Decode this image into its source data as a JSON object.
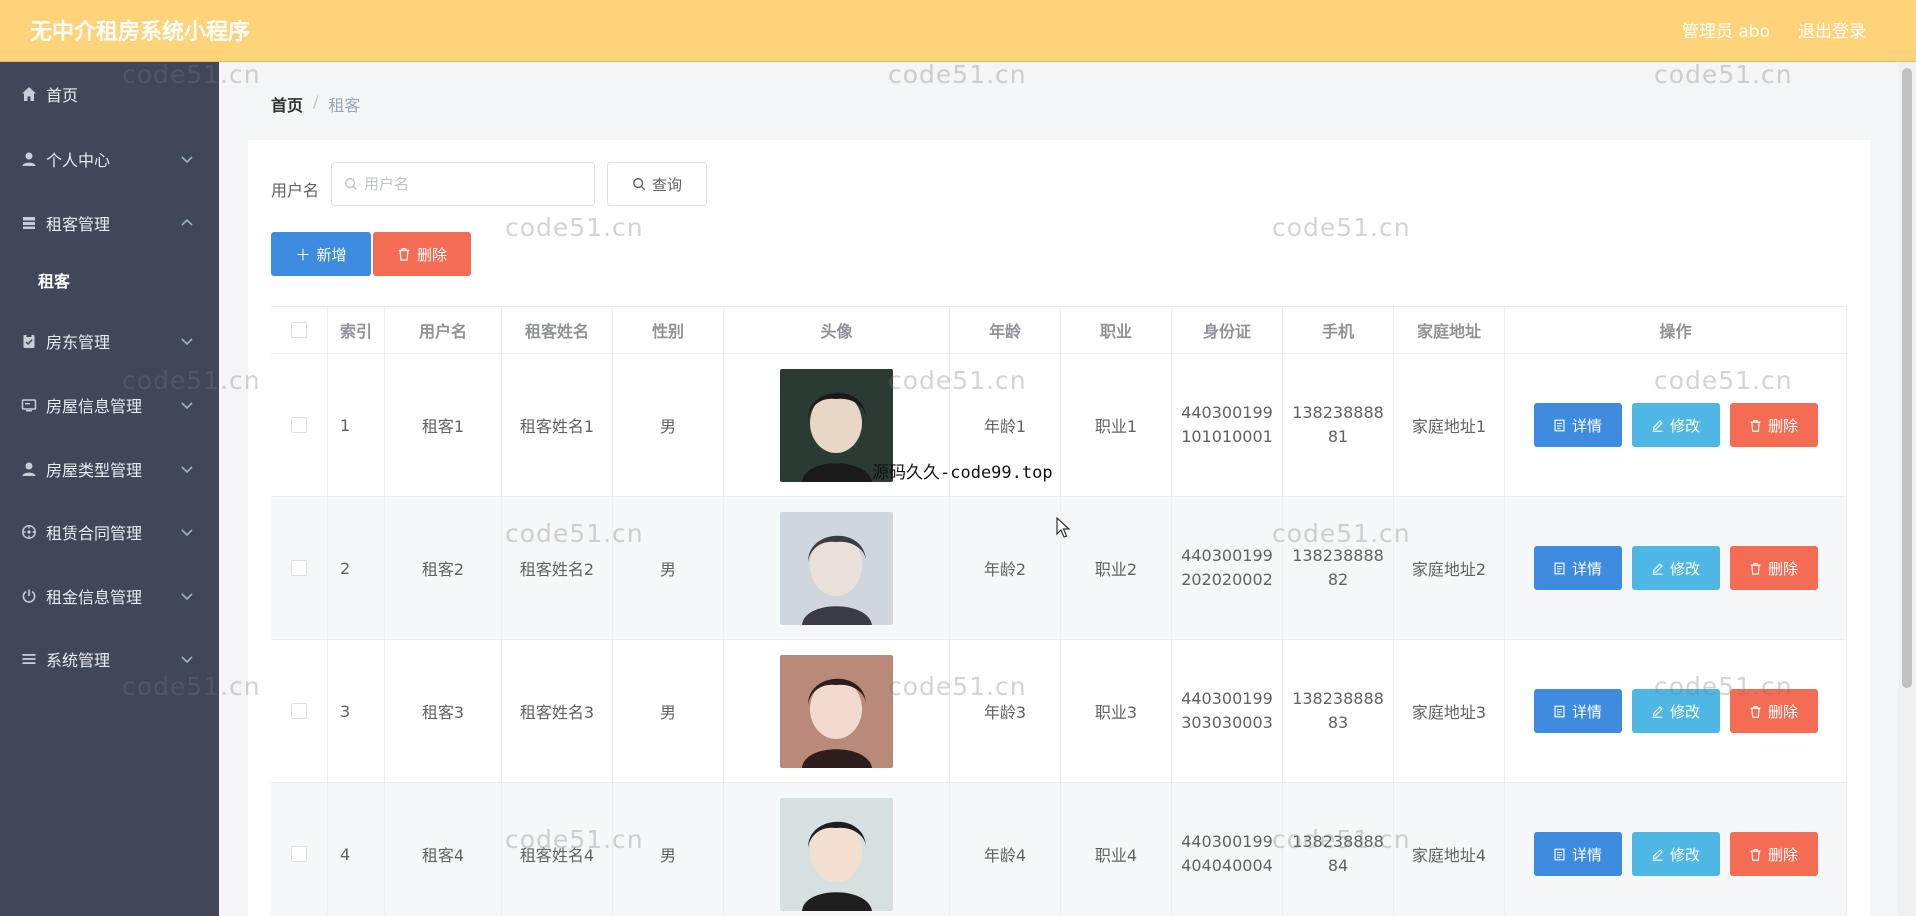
{
  "header": {
    "app_title": "无中介租房系统小程序",
    "admin_label": "管理员 abo",
    "logout_label": "退出登录",
    "bg_color": "#ffd37a"
  },
  "sidebar": {
    "items": [
      {
        "label": "首页",
        "icon": "home-icon"
      },
      {
        "label": "个人中心",
        "icon": "user-icon"
      },
      {
        "label": "租客管理",
        "icon": "list-icon",
        "expanded": true
      },
      {
        "label": "房东管理",
        "icon": "clipboard-icon"
      },
      {
        "label": "房屋信息管理",
        "icon": "monitor-icon"
      },
      {
        "label": "房屋类型管理",
        "icon": "user-icon"
      },
      {
        "label": "租赁合同管理",
        "icon": "compass-icon"
      },
      {
        "label": "租金信息管理",
        "icon": "power-icon"
      },
      {
        "label": "系统管理",
        "icon": "menu-icon"
      }
    ],
    "sub_item": "租客"
  },
  "breadcrumb": {
    "home": "首页",
    "separator": "/",
    "current": "租客"
  },
  "search": {
    "label": "用户名",
    "placeholder": "用户名",
    "query_label": "查询"
  },
  "actions": {
    "add_label": "新增",
    "delete_label": "删除"
  },
  "table": {
    "headers": [
      "索引",
      "用户名",
      "租客姓名",
      "性别",
      "头像",
      "年龄",
      "职业",
      "身份证",
      "手机",
      "家庭地址",
      "操作"
    ],
    "rows": [
      {
        "index": "1",
        "username": "租客1",
        "name": "租客姓名1",
        "gender": "男",
        "age": "年龄1",
        "job": "职业1",
        "id_card": "440300199101010001",
        "phone": "13823888881",
        "address": "家庭地址1"
      },
      {
        "index": "2",
        "username": "租客2",
        "name": "租客姓名2",
        "gender": "男",
        "age": "年龄2",
        "job": "职业2",
        "id_card": "440300199202020002",
        "phone": "13823888882",
        "address": "家庭地址2"
      },
      {
        "index": "3",
        "username": "租客3",
        "name": "租客姓名3",
        "gender": "男",
        "age": "年龄3",
        "job": "职业3",
        "id_card": "440300199303030003",
        "phone": "13823888883",
        "address": "家庭地址3"
      },
      {
        "index": "4",
        "username": "租客4",
        "name": "租客姓名4",
        "gender": "男",
        "age": "年龄4",
        "job": "职业4",
        "id_card": "440300199404040004",
        "phone": "13823888884",
        "address": "家庭地址4"
      }
    ],
    "op_detail": "详情",
    "op_edit": "修改",
    "op_delete": "删除"
  },
  "watermark": {
    "text": "code51.cn",
    "overlay_text": "源码久久-code99.top"
  }
}
